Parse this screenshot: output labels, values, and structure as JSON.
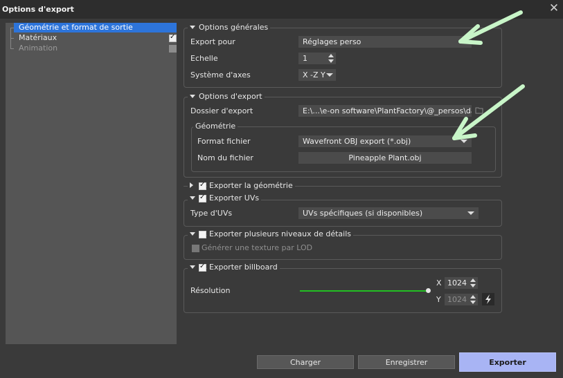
{
  "window": {
    "title": "Options d'export",
    "close_glyph": "✕"
  },
  "tree": {
    "items": [
      {
        "label": "Géométrie et format de sortie",
        "checked": null
      },
      {
        "label": "Matériaux",
        "checked": true
      },
      {
        "label": "Animation",
        "checked": false
      }
    ]
  },
  "general": {
    "title": "Options générales",
    "export_for_label": "Export pour",
    "export_for_value": "Réglages perso",
    "scale_label": "Echelle",
    "scale_value": "1",
    "axes_label": "Système d'axes",
    "axes_value": "X -Z Y"
  },
  "export_options": {
    "title": "Options d'export",
    "folder_label": "Dossier d'export",
    "folder_value": "E:\\...\\e-on software\\PlantFactory\\@_persos\\daz",
    "geometry": {
      "title": "Géométrie",
      "format_label": "Format fichier",
      "format_value": "Wavefront OBJ export (*.obj)",
      "filename_label": "Nom du fichier",
      "filename_value": "Pineapple Plant.obj"
    }
  },
  "export_geometry": {
    "label": "Exporter la géométrie",
    "checked": true
  },
  "export_uvs": {
    "label": "Exporter UVs",
    "checked": true,
    "type_label": "Type d'UVs",
    "type_value": "UVs spécifiques (si disponibles)"
  },
  "lod": {
    "label": "Exporter plusieurs niveaux de détails",
    "checked": false,
    "texture_label": "Générer une texture par LOD"
  },
  "billboard": {
    "label": "Exporter billboard",
    "checked": true,
    "resolution_label": "Résolution",
    "x_label": "X",
    "x_value": "1024",
    "y_label": "Y",
    "y_value": "1024"
  },
  "buttons": {
    "load": "Charger",
    "save": "Enregistrer",
    "export": "Exporter"
  },
  "colors": {
    "accent": "#2d74da",
    "slider": "#22c022",
    "export_button": "#a8b4f4",
    "annotation_arrow": "#c8f5c8"
  },
  "icons": {
    "browse": "folder-icon",
    "lock": "lightning-icon",
    "annotation": "arrow-icon"
  }
}
